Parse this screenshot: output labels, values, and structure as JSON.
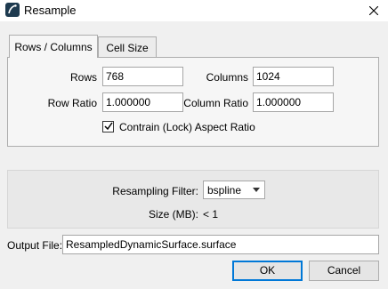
{
  "window": {
    "title": "Resample"
  },
  "tabs": [
    {
      "label": "Rows / Columns",
      "active": true
    },
    {
      "label": "Cell Size",
      "active": false
    }
  ],
  "rows_columns": {
    "rows_label": "Rows",
    "rows_value": "768",
    "columns_label": "Columns",
    "columns_value": "1024",
    "row_ratio_label": "Row Ratio",
    "row_ratio_value": "1.000000",
    "column_ratio_label": "Column Ratio",
    "column_ratio_value": "1.000000",
    "lock_aspect_label": "Contrain (Lock) Aspect Ratio",
    "lock_aspect_checked": true
  },
  "filter": {
    "label": "Resampling Filter:",
    "selected": "bspline",
    "size_label": "Size (MB):",
    "size_value": "< 1"
  },
  "output": {
    "label": "Output File:",
    "value": "ResampledDynamicSurface.surface"
  },
  "buttons": {
    "ok": "OK",
    "cancel": "Cancel"
  },
  "colors": {
    "accent": "#0078d7",
    "background": "#f0f0f0"
  }
}
